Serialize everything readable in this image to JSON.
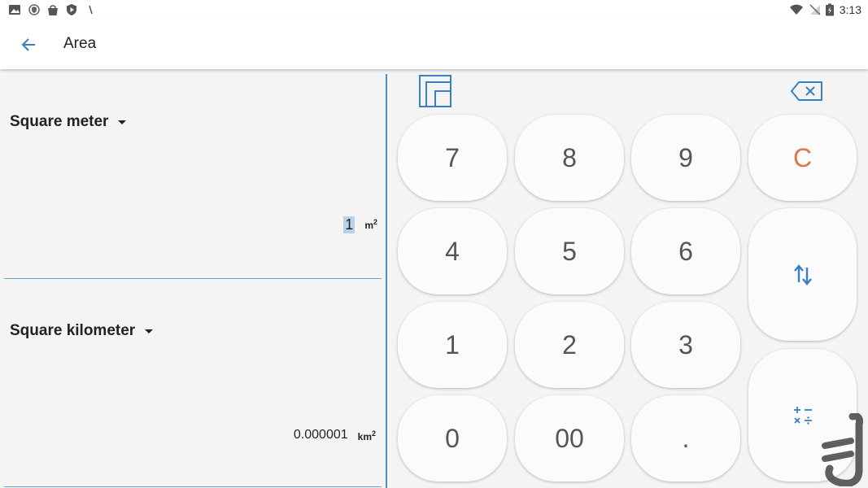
{
  "status_bar": {
    "time": "3:13",
    "left_icons": [
      "image-icon",
      "shield-icon",
      "bag-icon",
      "play-shield-icon",
      "slash-icon"
    ],
    "right_icons": [
      "wifi-icon",
      "no-signal-icon",
      "battery-icon"
    ]
  },
  "app_bar": {
    "title": "Area",
    "back_icon": "arrow-left-icon"
  },
  "converter": {
    "from": {
      "unit": "Square meter",
      "value": "1",
      "symbol": "m",
      "symbol_exp": "2"
    },
    "to": {
      "unit": "Square kilometer",
      "value": "0.000001",
      "symbol": "km",
      "symbol_exp": "2"
    }
  },
  "keypad": {
    "keys": {
      "k7": "7",
      "k8": "8",
      "k9": "9",
      "clear": "C",
      "k4": "4",
      "k5": "5",
      "k6": "6",
      "k1": "1",
      "k2": "2",
      "k3": "3",
      "k0": "0",
      "k00": "00",
      "dot": "."
    },
    "icons": [
      "layout-icon",
      "backspace-icon",
      "swap-icon",
      "calculator-icon"
    ]
  },
  "colors": {
    "accent": "#4f8fc0",
    "clear": "#d9784a",
    "selection": "#b9d2ea"
  }
}
